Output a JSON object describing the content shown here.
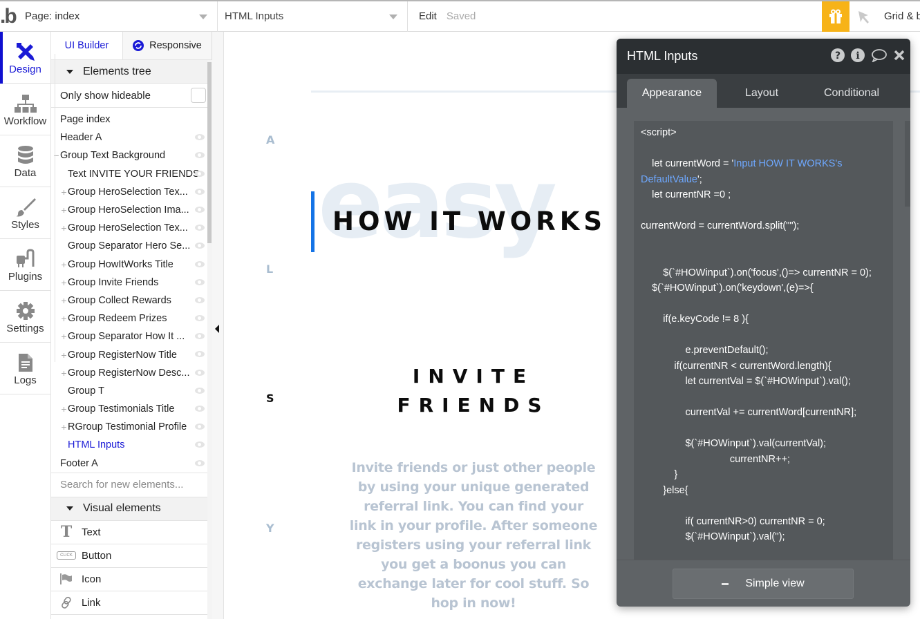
{
  "topbar": {
    "logo": ".b",
    "page_select": "Page: index",
    "element_select": "HTML Inputs",
    "edit_label": "Edit",
    "status": "Saved",
    "gift_icon": "gift-icon",
    "pointer_icon": "cursor-arrow-icon",
    "grid_label": "Grid & b",
    "accent_color": "#f7b318"
  },
  "leftnav": {
    "items": [
      {
        "label": "Design",
        "icon": "design-tools-icon",
        "active": true
      },
      {
        "label": "Workflow",
        "icon": "workflow-hierarchy-icon"
      },
      {
        "label": "Data",
        "icon": "database-icon"
      },
      {
        "label": "Styles",
        "icon": "paintbrush-icon"
      },
      {
        "label": "Plugins",
        "icon": "plug-icon"
      },
      {
        "label": "Settings",
        "icon": "gear-icon"
      },
      {
        "label": "Logs",
        "icon": "document-icon"
      }
    ]
  },
  "panel": {
    "tabs": {
      "ui_builder": "UI Builder",
      "responsive": "Responsive"
    },
    "elements_tree_header": "Elements tree",
    "only_show_hideable": "Only show hideable",
    "tree": [
      {
        "label": "Page index",
        "prefix": "",
        "indent": 0,
        "eye": false
      },
      {
        "label": "Header A",
        "prefix": "",
        "indent": 0,
        "eye": true
      },
      {
        "label": "Group Text Background",
        "prefix": "−",
        "indent": 0,
        "eye": true
      },
      {
        "label": "Text INVITE YOUR FRIENDS",
        "prefix": "",
        "indent": 1,
        "eye": true
      },
      {
        "label": "Group HeroSelection Tex...",
        "prefix": "+",
        "indent": 1,
        "eye": true
      },
      {
        "label": "Group HeroSelection Ima...",
        "prefix": "+",
        "indent": 1,
        "eye": true
      },
      {
        "label": "Group HeroSelection Tex...",
        "prefix": "+",
        "indent": 1,
        "eye": true
      },
      {
        "label": "Group Separator Hero Se...",
        "prefix": "",
        "indent": 1,
        "eye": true
      },
      {
        "label": "Group HowItWorks Title",
        "prefix": "+",
        "indent": 1,
        "eye": true
      },
      {
        "label": "Group Invite Friends",
        "prefix": "+",
        "indent": 1,
        "eye": true
      },
      {
        "label": "Group Collect Rewards",
        "prefix": "+",
        "indent": 1,
        "eye": true
      },
      {
        "label": "Group Redeem Prizes",
        "prefix": "+",
        "indent": 1,
        "eye": true
      },
      {
        "label": "Group Separator How It ...",
        "prefix": "+",
        "indent": 1,
        "eye": true
      },
      {
        "label": "Group RegisterNow Title",
        "prefix": "+",
        "indent": 1,
        "eye": true
      },
      {
        "label": "Group RegisterNow Desc...",
        "prefix": "+",
        "indent": 1,
        "eye": true
      },
      {
        "label": "Group T",
        "prefix": "",
        "indent": 1,
        "eye": true
      },
      {
        "label": "Group Testimonials Title",
        "prefix": "+",
        "indent": 1,
        "eye": true
      },
      {
        "label": "RGroup Testimonial Profile",
        "prefix": "+",
        "indent": 1,
        "eye": true
      },
      {
        "label": "HTML Inputs",
        "prefix": "",
        "indent": 1,
        "eye": true,
        "selected": true
      },
      {
        "label": "Footer A",
        "prefix": "",
        "indent": 0,
        "eye": true
      }
    ],
    "search_placeholder": "Search for new elements...",
    "visual_elements_header": "Visual elements",
    "visual_elements": [
      {
        "label": "Text",
        "icon": "text-t-icon"
      },
      {
        "label": "Button",
        "icon": "button-click-icon",
        "icon_text": "CLICK"
      },
      {
        "label": "Icon",
        "icon": "flag-icon"
      },
      {
        "label": "Link",
        "icon": "link-chain-icon"
      }
    ]
  },
  "canvas": {
    "side_letters": [
      "A",
      "L",
      "S",
      "Y"
    ],
    "background_word": "easy",
    "how_title": "HOW IT WORKS",
    "invite_title_line1": "INVITE",
    "invite_title_line2": "FRIENDS",
    "invite_desc": "Invite friends or just other people by using your unique generated referral link. You can find your link in your profile. After someone registers using your referral link you get a boonus you can exchange later for cool stuff. So hop in now!",
    "accent_bar_color": "#1473e6"
  },
  "inspector": {
    "title": "HTML Inputs",
    "header_icons": [
      "help-icon",
      "info-icon",
      "comment-icon",
      "close-icon"
    ],
    "tabs": [
      "Appearance",
      "Layout",
      "Conditional"
    ],
    "active_tab": "Appearance",
    "code_lines": [
      {
        "text": "<script>"
      },
      {
        "text": ""
      },
      {
        "text": "    let currentWord = '",
        "hl": "Input HOW IT WORKS's"
      },
      {
        "text": "",
        "hl": "DefaultValue",
        "after": "';"
      },
      {
        "text": "    let currentNR =0 ;"
      },
      {
        "text": ""
      },
      {
        "text": "currentWord = currentWord.split(\"\");"
      },
      {
        "text": ""
      },
      {
        "text": ""
      },
      {
        "text": "        $(`#HOWinput`).on('focus',()=> currentNR = 0);"
      },
      {
        "text": "    $(`#HOWinput`).on('keydown',(e)=>{"
      },
      {
        "text": ""
      },
      {
        "text": "        if(e.keyCode != 8 ){"
      },
      {
        "text": ""
      },
      {
        "text": "                e.preventDefault();"
      },
      {
        "text": "            if(currentNR < currentWord.length){"
      },
      {
        "text": "                let currentVal = $(`#HOWinput`).val();"
      },
      {
        "text": ""
      },
      {
        "text": "                currentVal += currentWord[currentNR];"
      },
      {
        "text": ""
      },
      {
        "text": "                $(`#HOWinput`).val(currentVal);"
      },
      {
        "text": "                                currentNR++;"
      },
      {
        "text": "            }"
      },
      {
        "text": "        }else{"
      },
      {
        "text": ""
      },
      {
        "text": "                if( currentNR>0) currentNR = 0;"
      },
      {
        "text": "                $(`#HOWinput`).val('');"
      }
    ],
    "code_highlight_color": "#6ea8ff",
    "simple_view_label": "Simple view"
  }
}
